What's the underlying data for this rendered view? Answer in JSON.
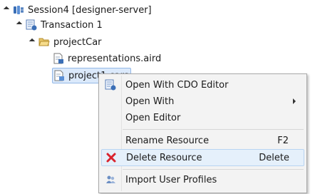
{
  "tree": {
    "session": {
      "label": "Session4 [designer-server]",
      "icon": "session-icon"
    },
    "transaction": {
      "label": "Transaction 1",
      "icon": "transaction-icon"
    },
    "project": {
      "label": "projectCar",
      "icon": "folder-open-icon"
    },
    "file1": {
      "label": "representations.aird",
      "icon": "aird-file-icon"
    },
    "file2": {
      "label": "project1.cars",
      "icon": "model-file-icon"
    }
  },
  "menu": {
    "items": [
      {
        "label": "Open With CDO Editor",
        "shortcut": "",
        "icon": "cdo-editor-icon"
      },
      {
        "label": "Open With",
        "shortcut": "",
        "icon": ""
      },
      {
        "label": "Open Editor",
        "shortcut": "",
        "icon": ""
      },
      {
        "label": "Rename Resource",
        "shortcut": "F2",
        "icon": ""
      },
      {
        "label": "Delete Resource",
        "shortcut": "Delete",
        "icon": "delete-icon"
      },
      {
        "label": "Import User Profiles",
        "shortcut": "",
        "icon": "users-icon"
      }
    ]
  },
  "colors": {
    "accent": "#3b6fb6",
    "selection": "#dbe9fb",
    "delete": "#d9232e"
  }
}
